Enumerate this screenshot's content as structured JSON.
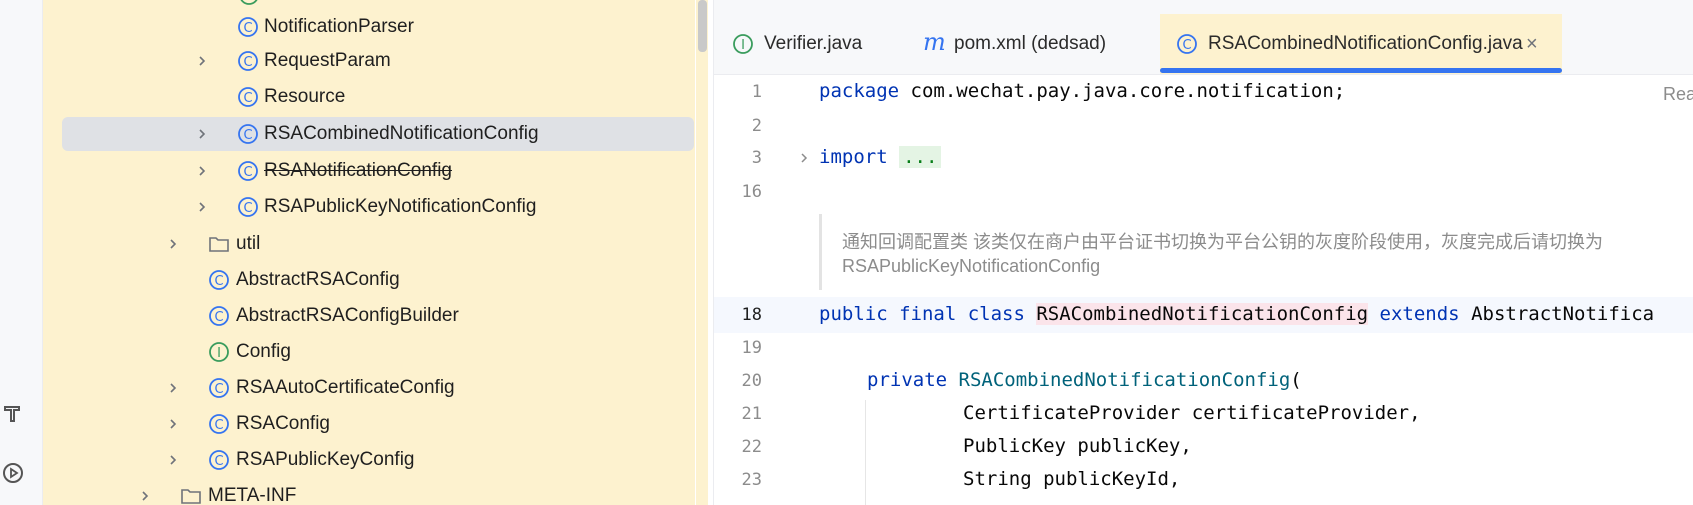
{
  "toolstrip": {
    "icons": [
      "hammer-icon",
      "run-icon"
    ]
  },
  "tree": {
    "items": [
      {
        "label": "NotificationParser",
        "icon": "class-icon",
        "expandable": false
      },
      {
        "label": "RequestParam",
        "icon": "class-icon",
        "expandable": true
      },
      {
        "label": "Resource",
        "icon": "class-icon",
        "expandable": false
      },
      {
        "label": "RSACombinedNotificationConfig",
        "icon": "class-icon",
        "expandable": true,
        "selected": true
      },
      {
        "label": "RSANotificationConfig",
        "icon": "class-icon",
        "expandable": true,
        "deprecated": true
      },
      {
        "label": "RSAPublicKeyNotificationConfig",
        "icon": "class-icon",
        "expandable": true
      },
      {
        "label": "util",
        "icon": "folder-icon",
        "expandable": true
      },
      {
        "label": "AbstractRSAConfig",
        "icon": "class-icon",
        "expandable": false
      },
      {
        "label": "AbstractRSAConfigBuilder",
        "icon": "class-icon",
        "expandable": false
      },
      {
        "label": "Config",
        "icon": "interface-icon",
        "expandable": false
      },
      {
        "label": "RSAAutoCertificateConfig",
        "icon": "class-icon",
        "expandable": true
      },
      {
        "label": "RSAConfig",
        "icon": "class-icon",
        "expandable": true
      },
      {
        "label": "RSAPublicKeyConfig",
        "icon": "class-icon",
        "expandable": true
      },
      {
        "label": "META-INF",
        "icon": "folder-icon",
        "expandable": true
      }
    ]
  },
  "tabs": [
    {
      "label": "Verifier.java",
      "icon": "interface-icon",
      "active": false
    },
    {
      "label": "pom.xml (dedsad)",
      "icon": "maven-icon",
      "active": false
    },
    {
      "label": "RSACombinedNotificationConfig.java",
      "icon": "class-icon",
      "active": true,
      "close": "×"
    }
  ],
  "editor": {
    "reader_mode": "Rea",
    "line_numbers": [
      "1",
      "2",
      "3",
      "16",
      "18",
      "19",
      "20",
      "21",
      "22",
      "23"
    ],
    "code": {
      "l1_kw": "package",
      "l1_rest": " com.wechat.pay.java.core.notification;",
      "l3_kw": "import",
      "l3_fold": "...",
      "doc1": "通知回调配置类 该类仅在商户由平台证书切换为平台公钥的灰度阶段使用，灰度完成后请切换为",
      "doc2": "RSAPublicKeyNotificationConfig",
      "l18_kw1": "public final class",
      "l18_cls": "RSACombinedNotificationConfig",
      "l18_kw2": "extends",
      "l18_rest": "AbstractNotifica",
      "l20_kw": "private",
      "l20_ctor": "RSACombinedNotificationConfig",
      "l20_rest": "(",
      "l21": "CertificateProvider certificateProvider,",
      "l22": "PublicKey publicKey,",
      "l23": "String publicKeyId,"
    }
  },
  "colors": {
    "tree_bg": "#fdf2cf",
    "accent": "#3574f0",
    "keyword": "#0033b3",
    "class_icon": "#3574f0",
    "interface_icon": "#3a9c5d"
  }
}
